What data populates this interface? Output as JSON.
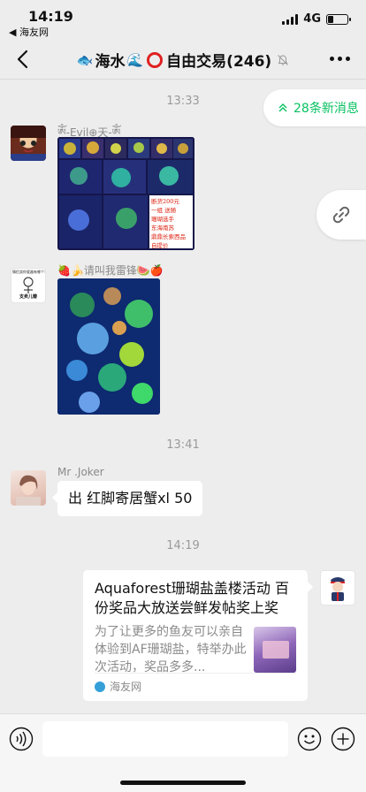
{
  "status_bar": {
    "time": "14:19",
    "back_app": "◀ 海友网",
    "network": "4G",
    "battery_level": 0.3
  },
  "nav": {
    "title_emoji": "🐟",
    "title_main": "海水",
    "title_wave": "🌊",
    "title_rest": "自由交易(246)",
    "icons": [
      "back-arrow",
      "mute-bell",
      "more-dots"
    ]
  },
  "chat": {
    "new_messages_label": "28条新消息",
    "timestamps": [
      "13:33",
      "13:41",
      "14:19"
    ],
    "messages": [
      {
        "sender": "ༀ-Evil⊕天-ༀ",
        "type": "image",
        "image_caption_lines": [
          "断货200元",
          "一组 送随",
          "珊瑚选手",
          "东海南苏",
          "鼎鼎长索西品",
          "自提价"
        ]
      },
      {
        "sender": "🍓🍌请叫我雷锋🍉🍎",
        "avatar_text": [
          "情侣卖你瓷器有哪个不",
          "支卖儿瓣"
        ],
        "type": "image"
      },
      {
        "sender": "Mr .Joker",
        "type": "text",
        "text": "出 红脚寄居蟹xl 50"
      },
      {
        "sender": "",
        "type": "link_card",
        "card": {
          "title": "Aquaforest珊瑚盐盖楼活动 百份奖品大放送尝鲜发帖奖上奖",
          "description": "为了让更多的鱼友可以亲自体验到AF珊瑚盐，特举办此次活动，奖品多多...",
          "source": "海友网"
        }
      }
    ]
  },
  "input_bar": {
    "placeholder": ""
  },
  "colors": {
    "accent_green": "#07c160",
    "background": "#ededed"
  }
}
